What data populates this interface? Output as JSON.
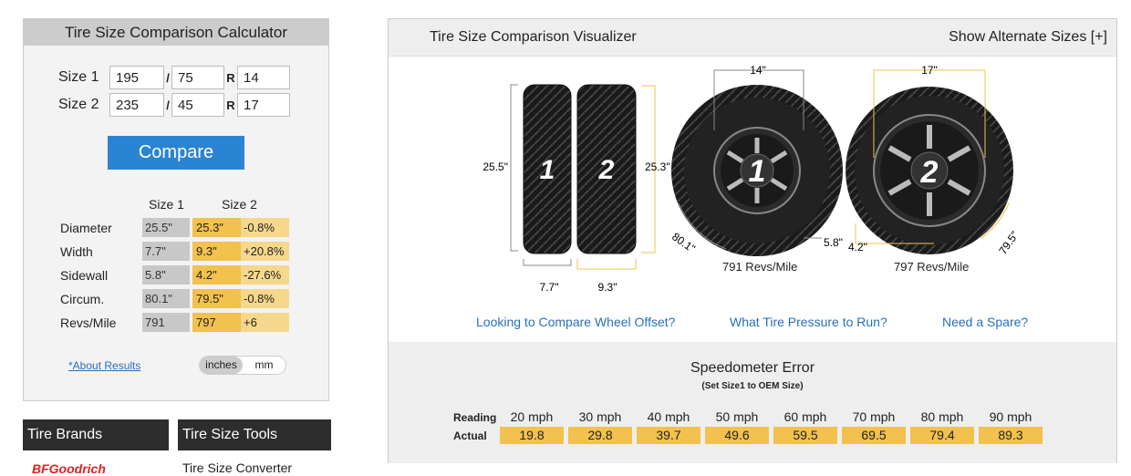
{
  "calculator": {
    "title": "Tire Size Comparison Calculator",
    "size1": {
      "label": "Size 1",
      "width": "195",
      "aspect": "75",
      "rim": "14"
    },
    "size2": {
      "label": "Size 2",
      "width": "235",
      "aspect": "45",
      "rim": "17"
    },
    "slash": "/",
    "r": "R",
    "compare_label": "Compare",
    "col_size1": "Size 1",
    "col_size2": "Size 2",
    "rows": [
      {
        "name": "Diameter",
        "v1": "25.5\"",
        "v2": "25.3\"",
        "diff": "-0.8%"
      },
      {
        "name": "Width",
        "v1": "7.7\"",
        "v2": "9.3\"",
        "diff": "+20.8%"
      },
      {
        "name": "Sidewall",
        "v1": "5.8\"",
        "v2": "4.2\"",
        "diff": "-27.6%"
      },
      {
        "name": "Circum.",
        "v1": "80.1\"",
        "v2": "79.5\"",
        "diff": "-0.8%"
      },
      {
        "name": "Revs/Mile",
        "v1": "791",
        "v2": "797",
        "diff": "+6"
      }
    ],
    "about_link": "*About Results",
    "unit_inches": "inches",
    "unit_mm": "mm"
  },
  "tabs": {
    "brands_title": "Tire Brands",
    "brand_logo": "BFGoodrich",
    "tools_title": "Tire Size Tools",
    "tools_first": "Tire Size Converter"
  },
  "visualizer": {
    "title": "Tire Size Comparison Visualizer",
    "alt_sizes": "Show Alternate Sizes [+]",
    "tire1_num": "1",
    "tire2_num": "2",
    "diam1": "25.5\"",
    "diam2": "25.3\"",
    "width1": "7.7\"",
    "width2": "9.3\"",
    "rim1": "14\"",
    "rim2": "17\"",
    "sidewall1": "5.8\"",
    "sidewall2": "4.2\"",
    "circ1": "80.1\"",
    "circ2": "79.5\"",
    "revs1": "791 Revs/Mile",
    "revs2": "797 Revs/Mile",
    "link_offset": "Looking to Compare Wheel Offset?",
    "link_pressure": "What Tire Pressure to Run?",
    "link_spare": "Need a Spare?",
    "accent": "#f2c14e"
  },
  "speedometer": {
    "title": "Speedometer Error",
    "subtitle": "(Set Size1 to OEM Size)",
    "reading_label": "Reading",
    "actual_label": "Actual",
    "readings": [
      "20 mph",
      "30 mph",
      "40 mph",
      "50 mph",
      "60 mph",
      "70 mph",
      "80 mph",
      "90 mph"
    ],
    "actuals": [
      "19.8",
      "29.8",
      "39.7",
      "49.6",
      "59.5",
      "69.5",
      "79.4",
      "89.3"
    ]
  }
}
